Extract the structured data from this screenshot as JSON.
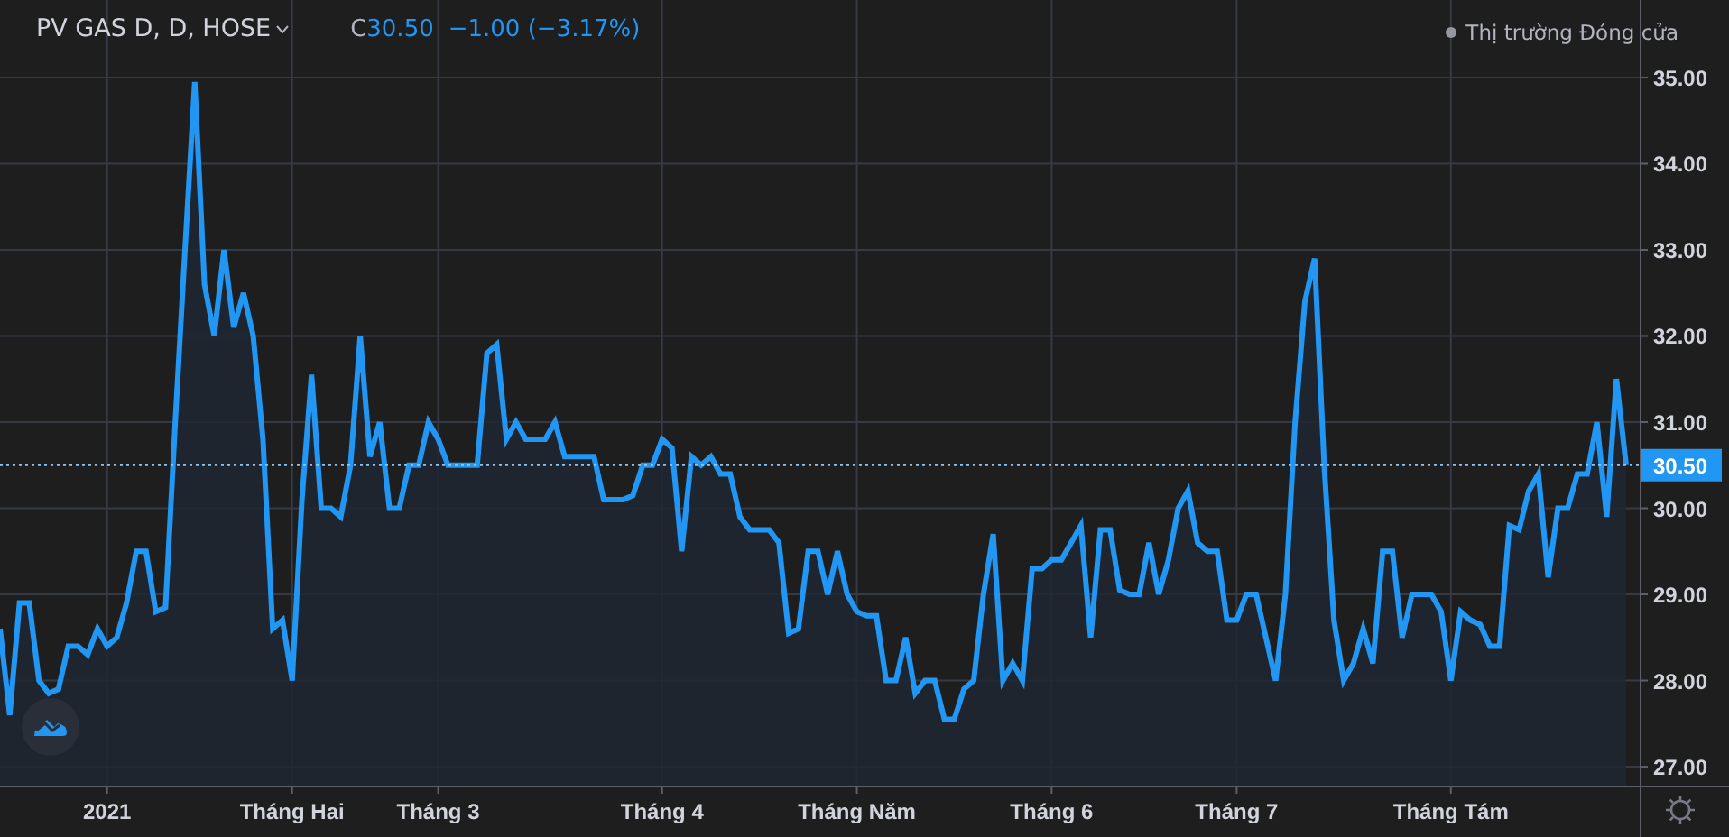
{
  "header": {
    "symbol": "PV GAS D, D, HOSE",
    "close_label": "C",
    "close_value": "30.50",
    "change": "−1.00 (−3.17%)",
    "market_status": "Thị trường Đóng cửa"
  },
  "chart": {
    "chart_data": {
      "type": "area",
      "grid": true,
      "categories": [
        null,
        null,
        null,
        null,
        null,
        null,
        null,
        null,
        null,
        null,
        null,
        "2021",
        null,
        null,
        null,
        null,
        null,
        null,
        null,
        null,
        null,
        null,
        null,
        null,
        null,
        null,
        null,
        null,
        null,
        null,
        "Tháng Hai",
        null,
        null,
        null,
        null,
        null,
        null,
        null,
        null,
        null,
        null,
        null,
        null,
        null,
        null,
        "Tháng 3",
        null,
        null,
        null,
        null,
        null,
        null,
        null,
        null,
        null,
        null,
        null,
        null,
        null,
        null,
        null,
        null,
        null,
        null,
        null,
        null,
        null,
        null,
        "Tháng 4",
        null,
        null,
        null,
        null,
        null,
        null,
        null,
        null,
        null,
        null,
        null,
        null,
        null,
        null,
        null,
        null,
        null,
        null,
        null,
        "Tháng Năm",
        null,
        null,
        null,
        null,
        null,
        null,
        null,
        null,
        null,
        null,
        null,
        null,
        null,
        null,
        null,
        null,
        null,
        null,
        null,
        "Tháng 6",
        null,
        null,
        null,
        null,
        null,
        null,
        null,
        null,
        null,
        null,
        null,
        null,
        null,
        null,
        null,
        null,
        null,
        null,
        "Tháng 7",
        null,
        null,
        null,
        null,
        null,
        null,
        null,
        null,
        null,
        null,
        null,
        null,
        null,
        null,
        null,
        null,
        null,
        null,
        null,
        null,
        null,
        "Tháng Tám",
        null,
        null,
        null,
        null,
        null,
        null,
        null,
        null,
        null,
        null,
        null,
        null,
        null,
        null,
        null,
        null,
        null,
        null
      ],
      "series": [
        {
          "color": "#2196f3",
          "values": [
            28.6,
            27.6,
            28.9,
            28.9,
            28.0,
            27.85,
            27.9,
            28.4,
            28.4,
            28.3,
            28.6,
            28.4,
            28.5,
            28.9,
            29.5,
            29.5,
            28.8,
            28.85,
            31.0,
            33.0,
            34.95,
            32.6,
            32.0,
            33.0,
            32.1,
            32.5,
            32.0,
            30.8,
            28.6,
            28.7,
            28.0,
            30.1,
            31.55,
            30.0,
            30.0,
            29.9,
            30.5,
            32.0,
            30.6,
            31.0,
            30.0,
            30.0,
            30.5,
            30.5,
            31.0,
            30.8,
            30.5,
            30.5,
            30.5,
            30.5,
            31.8,
            31.9,
            30.8,
            31.0,
            30.8,
            30.8,
            30.8,
            31.0,
            30.6,
            30.6,
            30.6,
            30.6,
            30.1,
            30.1,
            30.1,
            30.15,
            30.5,
            30.5,
            30.8,
            30.7,
            29.5,
            30.6,
            30.5,
            30.6,
            30.4,
            30.4,
            29.9,
            29.75,
            29.75,
            29.75,
            29.6,
            28.55,
            28.6,
            29.5,
            29.5,
            29.0,
            29.5,
            29.0,
            28.8,
            28.75,
            28.75,
            28.0,
            28.0,
            28.5,
            27.85,
            28.0,
            28.0,
            27.55,
            27.55,
            27.9,
            28.0,
            29.0,
            29.7,
            28.0,
            28.2,
            28.0,
            29.3,
            29.3,
            29.4,
            29.4,
            29.6,
            29.8,
            28.5,
            29.75,
            29.75,
            29.05,
            29.0,
            29.0,
            29.6,
            29.0,
            29.4,
            30.0,
            30.2,
            29.6,
            29.5,
            29.5,
            28.7,
            28.7,
            29.0,
            29.0,
            28.5,
            28.0,
            29.0,
            31.0,
            32.4,
            32.9,
            30.5,
            28.7,
            28.0,
            28.2,
            28.6,
            28.2,
            29.5,
            29.5,
            28.5,
            29.0,
            29.0,
            29.0,
            28.8,
            28.0,
            28.8,
            28.7,
            28.65,
            28.4,
            28.4,
            29.8,
            29.75,
            30.2,
            30.4,
            29.2,
            30.0,
            30.0,
            30.4,
            30.4,
            31.0,
            29.9,
            31.5,
            30.5
          ]
        }
      ],
      "yticks": [
        {
          "value": 27,
          "label": "27.00"
        },
        {
          "value": 28,
          "label": "28.00"
        },
        {
          "value": 29,
          "label": "29.00"
        },
        {
          "value": 30,
          "label": "30.00"
        },
        {
          "value": 31,
          "label": "31.00"
        },
        {
          "value": 32,
          "label": "32.00"
        },
        {
          "value": 33,
          "label": "33.00"
        },
        {
          "value": 34,
          "label": "34.00"
        },
        {
          "value": 35,
          "label": "35.00"
        }
      ],
      "ylim": [
        26.77,
        35.9
      ],
      "ref_lines": [
        {
          "axis": "y",
          "value": 30.5,
          "label": "30.50"
        }
      ]
    }
  }
}
